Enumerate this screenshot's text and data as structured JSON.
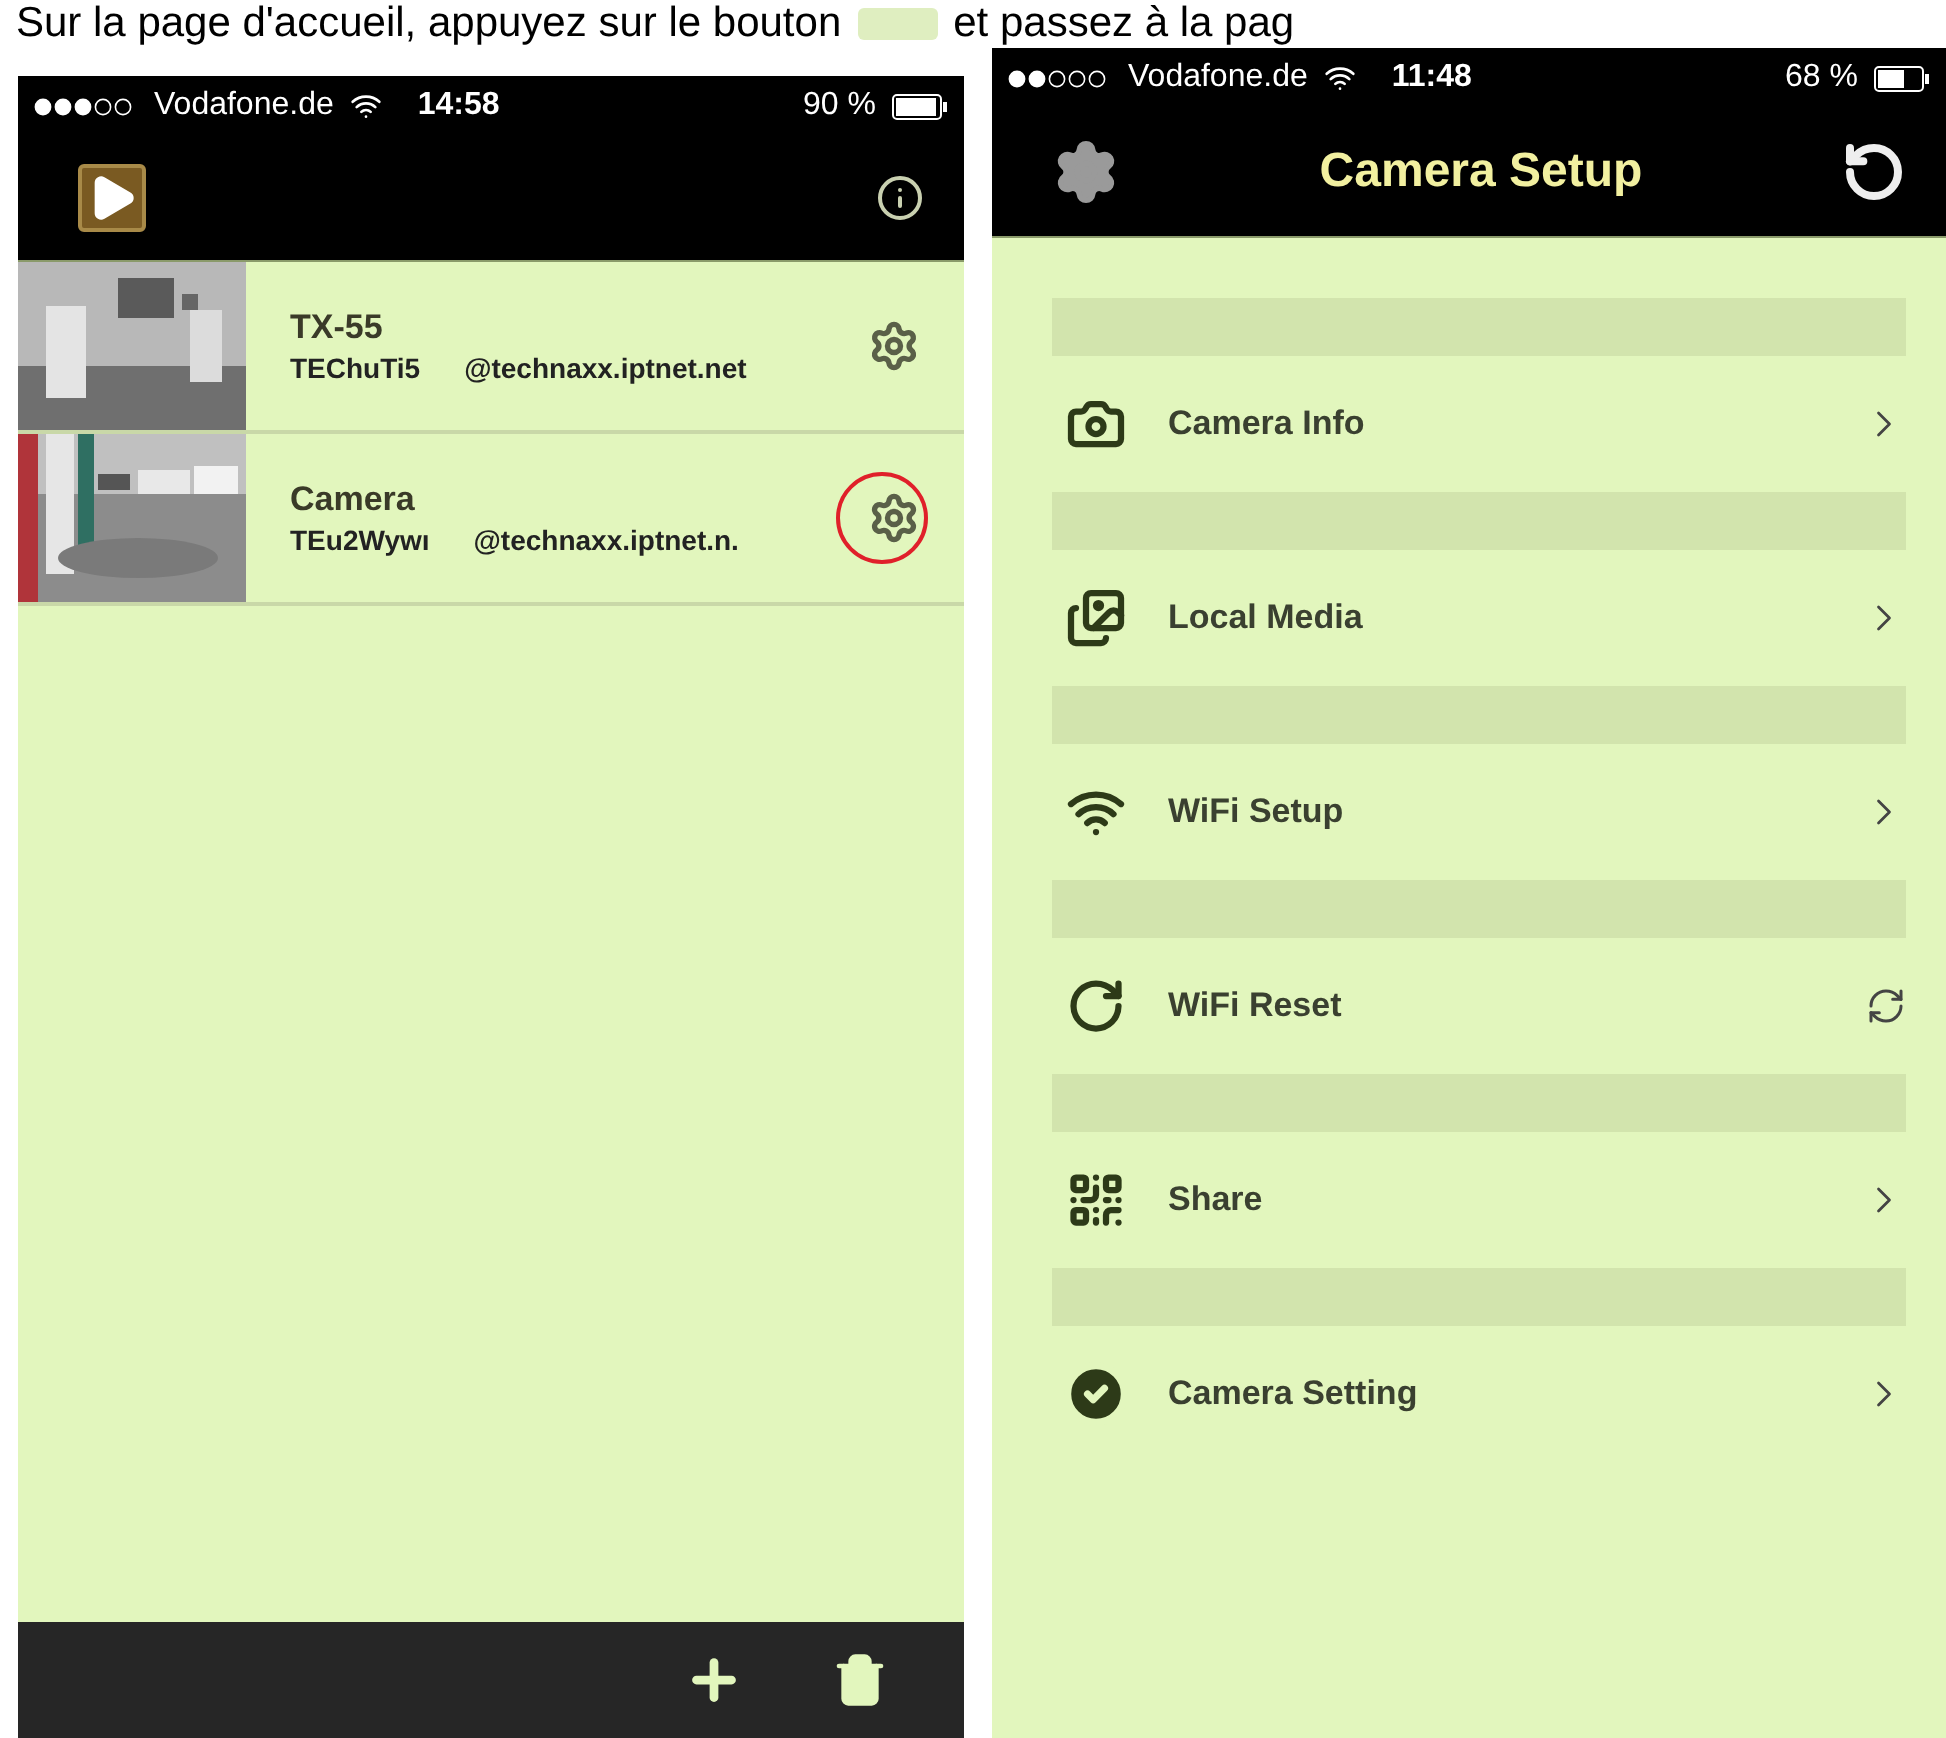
{
  "caption": {
    "before": "Sur la page d'accueil, appuyez sur le bouton",
    "after": "et passez à la pag"
  },
  "home": {
    "status": {
      "carrier": "Vodafone.de",
      "time": "14:58",
      "battery": "90 %"
    },
    "cameras": [
      {
        "name": "TX-55",
        "uid": "TEChuTi5",
        "domain": "@technaxx.iptnet.net",
        "highlighted": false
      },
      {
        "name": "Camera",
        "uid": "TEu2Wywı",
        "domain": "@technaxx.iptnet.n.",
        "highlighted": true
      }
    ]
  },
  "setup": {
    "status": {
      "carrier": "Vodafone.de",
      "time": "11:48",
      "battery": "68 %"
    },
    "title": "Camera Setup",
    "items": [
      {
        "label": "Camera Info",
        "kind": "chevron"
      },
      {
        "label": "Local Media",
        "kind": "chevron"
      },
      {
        "label": "WiFi Setup",
        "kind": "chevron"
      },
      {
        "label": "WiFi Reset",
        "kind": "refresh"
      },
      {
        "label": "Share",
        "kind": "chevron"
      },
      {
        "label": "Camera Setting",
        "kind": "chevron"
      }
    ]
  }
}
